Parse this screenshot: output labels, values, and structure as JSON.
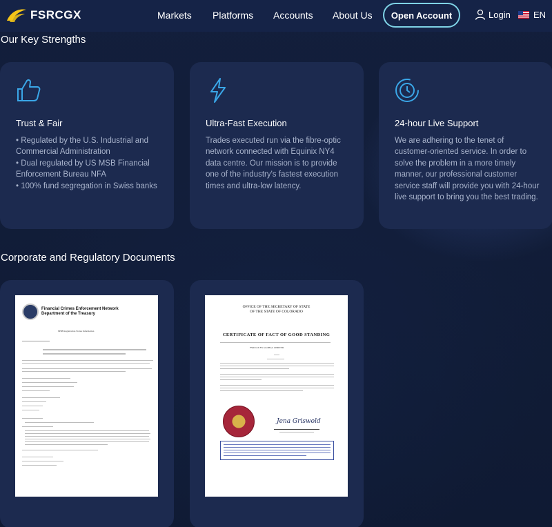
{
  "brand": {
    "name": "FSRCGX",
    "logo": "wave-logo-icon"
  },
  "nav": {
    "items": [
      {
        "label": "Markets"
      },
      {
        "label": "Platforms"
      },
      {
        "label": "Accounts"
      },
      {
        "label": "About Us"
      }
    ],
    "open_account": "Open Account",
    "login": "Login",
    "language": "EN"
  },
  "strengths": {
    "heading": "Our Key Strengths",
    "cards": [
      {
        "icon": "thumbs-up-icon",
        "title": "Trust & Fair",
        "bullets": [
          "• Regulated by the U.S. Industrial and Commercial Administration",
          "• Dual regulated by US MSB Financial Enforcement Bureau NFA",
          "• 100% fund segregation in Swiss banks"
        ]
      },
      {
        "icon": "lightning-icon",
        "title": "Ultra-Fast Execution",
        "text": "Trades executed run via the fibre-optic network connected with Equinix NY4 data centre. Our mission is to provide one of the industry's fastest execution times and ultra-low latency."
      },
      {
        "icon": "support-clock-icon",
        "title": "24-hour Live Support",
        "text": "We are adhering to the tenet of customer-oriented service. In order to solve the problem in a more timely manner, our professional customer service staff will provide you with 24-hour live support to bring you the best trading."
      }
    ]
  },
  "documents": {
    "heading": "Corporate and Regulatory Documents",
    "items": [
      {
        "header_line1": "Financial Crimes Enforcement Network",
        "header_line2": "Department of the Treasury",
        "subtitle": "MSB Registration Status Information"
      },
      {
        "office_line1": "OFFICE OF THE SECRETARY OF STATE",
        "office_line2": "OF THE STATE OF COLORADO",
        "title": "CERTIFICATE OF FACT OF GOOD STANDING",
        "company": "FSRCGX FX GLOBAL LIMITED",
        "signature": "Jena Griswold"
      }
    ]
  }
}
